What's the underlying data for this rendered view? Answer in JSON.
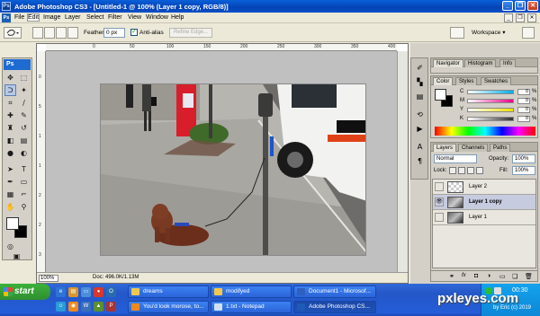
{
  "window": {
    "title": "Adobe Photoshop CS3 - [Untitled-1 @ 100% (Layer 1 copy, RGB/8)]",
    "app_badge": "Ps",
    "minimize": "_",
    "restore": "❐",
    "close": "✕"
  },
  "menubar": {
    "ps_badge": "Ps",
    "items": [
      "File",
      "Edit",
      "Image",
      "Layer",
      "Select",
      "Filter",
      "View",
      "Window",
      "Help"
    ],
    "active_item": "Edit"
  },
  "options": {
    "feather_label": "Feather:",
    "feather_value": "0 px",
    "antialias_label": "Anti-alias",
    "antialias_checked": true,
    "refine_edge_label": "Refine Edge...",
    "workspace_label": "Workspace ▾"
  },
  "toolbox": {
    "logo": "Ps",
    "foreground_color": "#ffffff",
    "background_color": "#000000"
  },
  "ruler": {
    "h_ticks": [
      "0",
      "50",
      "100",
      "150",
      "200",
      "250",
      "300",
      "350",
      "400"
    ],
    "v_ticks": [
      "0",
      "5",
      "1",
      "1",
      "2",
      "2",
      "3"
    ]
  },
  "document": {
    "zoom": "100%",
    "doc_size": "Doc: 496.0K/1.13M"
  },
  "navigator_panel": {
    "tabs": [
      "Navigator",
      "Histogram",
      "Info"
    ]
  },
  "color_panel": {
    "tabs": [
      "Color",
      "Styles",
      "Swatches"
    ],
    "channels": [
      {
        "letter": "C",
        "value": "0",
        "unit": "%",
        "color": "#00b0e8"
      },
      {
        "letter": "M",
        "value": "0",
        "unit": "%",
        "color": "#e8008c"
      },
      {
        "letter": "Y",
        "value": "0",
        "unit": "%",
        "color": "#f0e000"
      },
      {
        "letter": "K",
        "value": "0",
        "unit": "%",
        "color": "#303030"
      }
    ]
  },
  "layers_panel": {
    "tabs": [
      "Layers",
      "Channels",
      "Paths"
    ],
    "blend_mode": "Normal",
    "opacity_label": "Opacity:",
    "opacity": "100%",
    "lock_label": "Lock:",
    "fill_label": "Fill:",
    "fill": "100%",
    "layers": [
      {
        "name": "Layer 2",
        "visible": false,
        "selected": false
      },
      {
        "name": "Layer 1 copy",
        "visible": true,
        "selected": true
      },
      {
        "name": "Layer 1",
        "visible": false,
        "selected": false
      }
    ]
  },
  "taskbar": {
    "start_label": "start",
    "tasks_top": [
      "dreams",
      "modifyed",
      "Document1 - Microsof..."
    ],
    "tasks_bottom": [
      "You'd look morose, to...",
      "1.txt - Notepad",
      "Adobe Photoshop CS..."
    ],
    "active_task": "Adobe Photoshop CS...",
    "clock": "00:30"
  },
  "watermark": {
    "text": "pxleyes.com",
    "sub": "by Eric (c) 2019"
  }
}
